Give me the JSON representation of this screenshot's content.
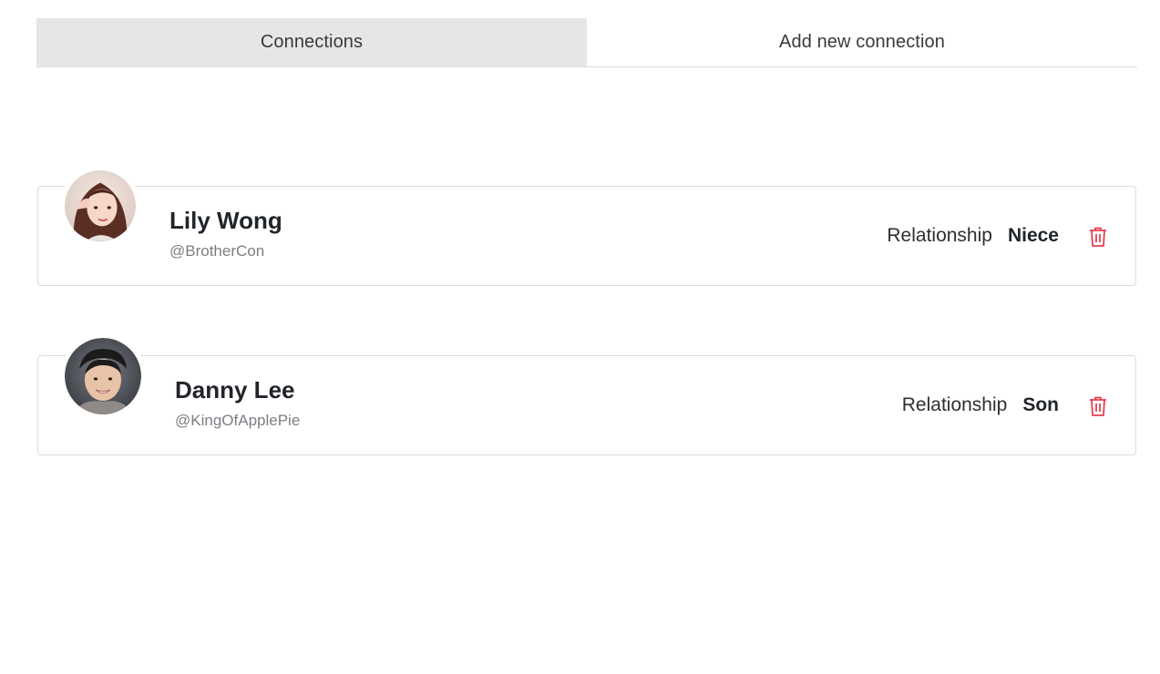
{
  "tabs": [
    {
      "label": "Connections",
      "active": true
    },
    {
      "label": "Add new connection",
      "active": false
    }
  ],
  "connections": [
    {
      "name": "Lily Wong",
      "handle": "@BrotherCon",
      "relationship_label": "Relationship",
      "relationship": "Niece",
      "avatar_icon": "user-avatar-photo"
    },
    {
      "name": "Danny Lee",
      "handle": "@KingOfApplePie",
      "relationship_label": "Relationship",
      "relationship": "Son",
      "avatar_icon": "user-avatar-photo"
    }
  ],
  "colors": {
    "active_tab_bg": "#e6e6e6",
    "delete_icon": "#e83e4f",
    "border": "#dcdcdc",
    "handle_text": "#7b7f83"
  }
}
